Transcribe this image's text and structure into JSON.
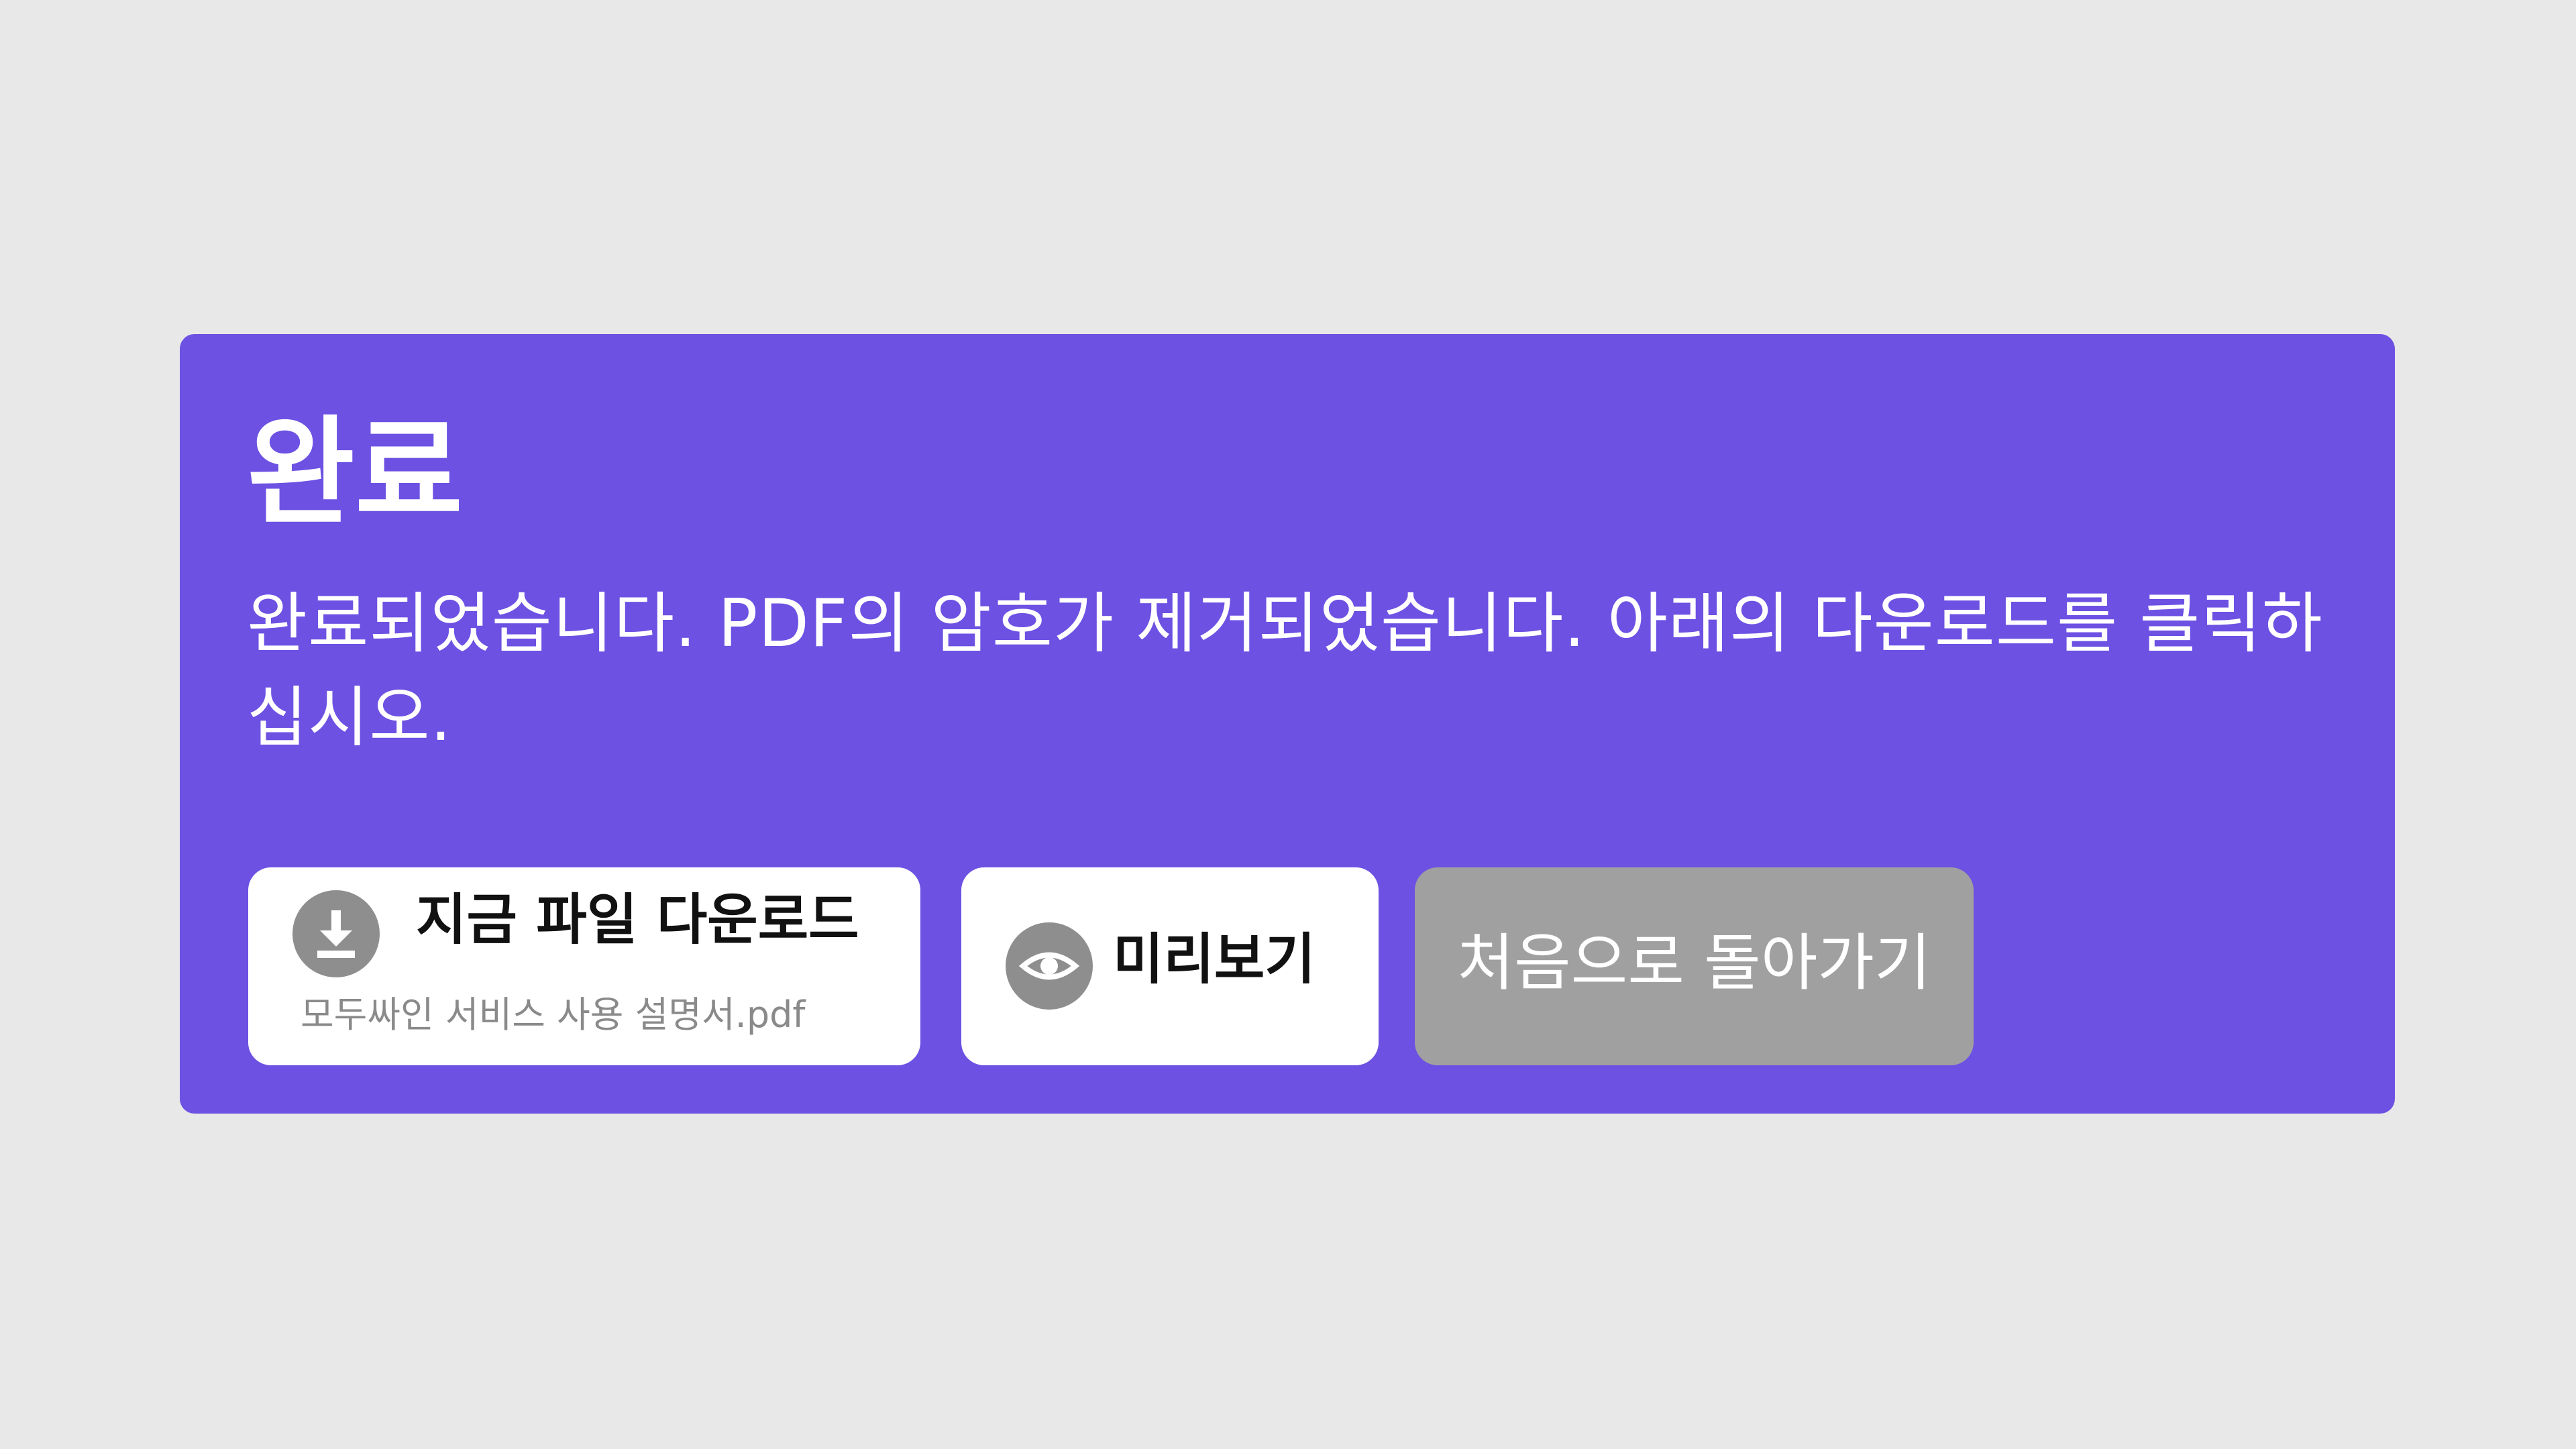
{
  "colors": {
    "page_background": "#e8e8e8",
    "panel_background": "#6c51e3",
    "button_white": "#ffffff",
    "button_disabled": "#a0a0a0",
    "icon_circle": "#8e8e8e"
  },
  "panel": {
    "title": "완료",
    "message": "완료되었습니다. PDF의 암호가 제거되었습니다. 아래의 다운로드를 클릭하십시오."
  },
  "buttons": {
    "download": {
      "label": "지금 파일 다운로드",
      "filename": "모두싸인 서비스 사용 설명서.pdf",
      "icon": "download-icon"
    },
    "preview": {
      "label": "미리보기",
      "icon": "eye-icon"
    },
    "restart": {
      "label": "처음으로 돌아가기"
    }
  }
}
